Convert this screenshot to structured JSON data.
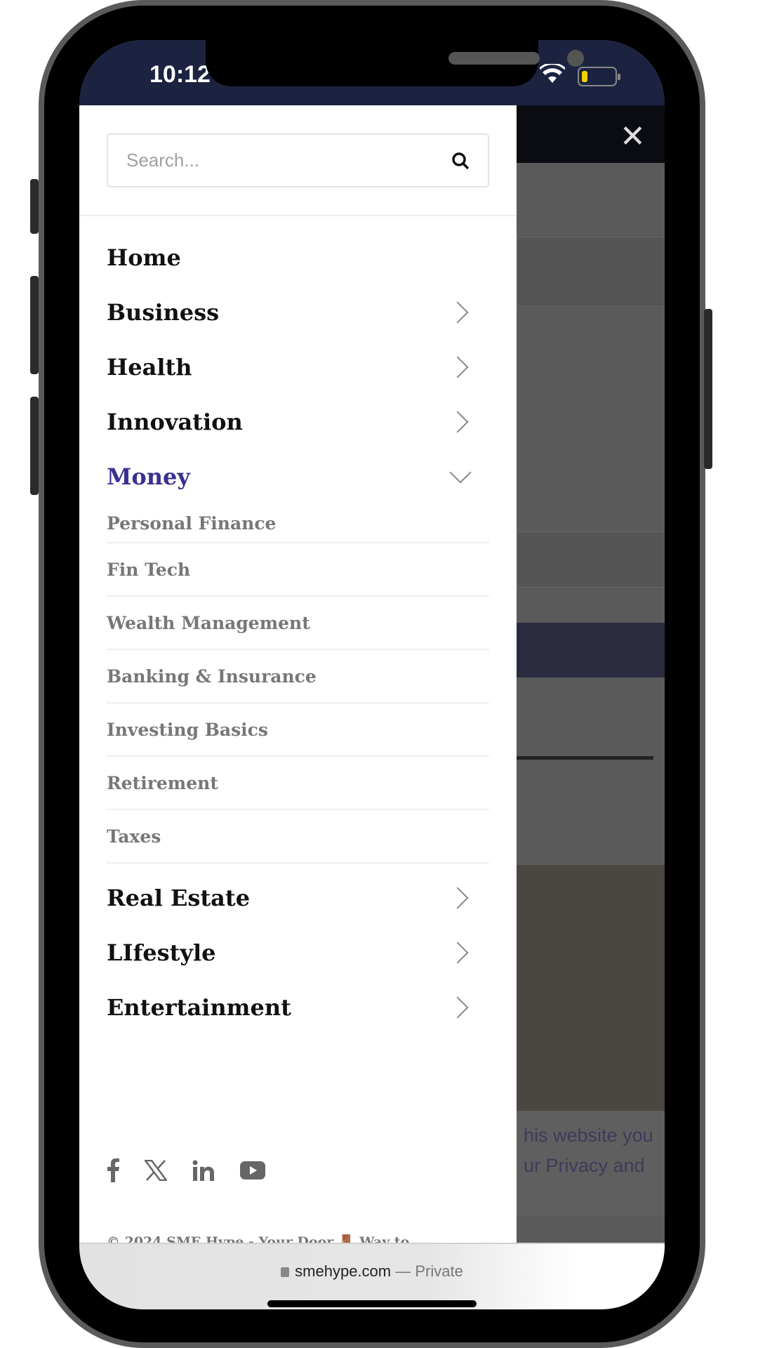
{
  "status_bar": {
    "time": "10:12"
  },
  "search": {
    "placeholder": "Search..."
  },
  "menu": [
    {
      "label": "Home",
      "has_children": false
    },
    {
      "label": "Business",
      "has_children": true
    },
    {
      "label": "Health",
      "has_children": true
    },
    {
      "label": "Innovation",
      "has_children": true
    },
    {
      "label": "Money",
      "has_children": true,
      "expanded": true
    },
    {
      "label": "Real Estate",
      "has_children": true
    },
    {
      "label": "LIfestyle",
      "has_children": true
    },
    {
      "label": "Entertainment",
      "has_children": true
    }
  ],
  "money_submenu": [
    "Personal Finance",
    "Fin Tech",
    "Wealth Management",
    "Banking & Insurance",
    "Investing Basics",
    "Retirement",
    "Taxes"
  ],
  "social": [
    "facebook-icon",
    "x-icon",
    "linkedin-icon",
    "youtube-icon"
  ],
  "footer": {
    "prefix": "© 2024 ",
    "site": "SME Hype",
    "middle": " - Your Door 🚪 Way to Information | Designed with love by xploreUX."
  },
  "background": {
    "cookie_line1": "his website you",
    "cookie_line2": "ur Privacy and"
  },
  "browser": {
    "url": "smehype.com",
    "mode": "— Private"
  },
  "colors": {
    "accent": "#3a3091",
    "status_bar": "#1c2340"
  }
}
